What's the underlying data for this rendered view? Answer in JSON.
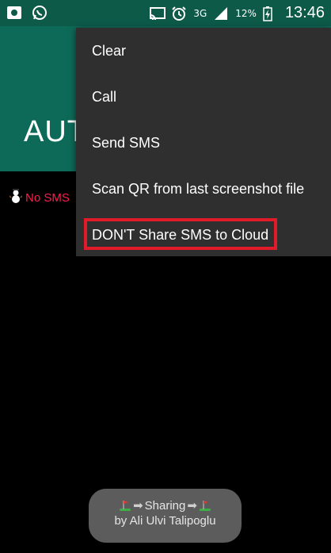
{
  "status_bar": {
    "network": "3G",
    "battery_percent": "12%",
    "time": "13:46",
    "icons": [
      "screenshot-icon",
      "whatsapp-icon",
      "cast-icon",
      "alarm-icon",
      "signal-icon",
      "battery-charging-icon"
    ]
  },
  "app_bar": {
    "title": "AUT"
  },
  "content": {
    "status_text": "No SMS",
    "status_icon": "snowman-icon",
    "status_color": "#ff1d4d"
  },
  "menu": {
    "items": [
      {
        "label": "Clear"
      },
      {
        "label": "Call"
      },
      {
        "label": "Send SMS"
      },
      {
        "label": "Scan QR from last screenshot file"
      },
      {
        "label": "DON'T Share SMS to Cloud"
      }
    ],
    "highlight_color": "#e11b2a"
  },
  "toast": {
    "line1": "Sharing",
    "line2": "by Ali Ulvi Talipoglu",
    "icons": [
      "golf-flag-icon",
      "right-arrow-icon",
      "right-arrow-icon",
      "golf-flag-icon"
    ]
  },
  "colors": {
    "app_bar": "#0e6a58",
    "status_bar": "#0d5a49",
    "menu_bg": "#2f2f2f"
  }
}
